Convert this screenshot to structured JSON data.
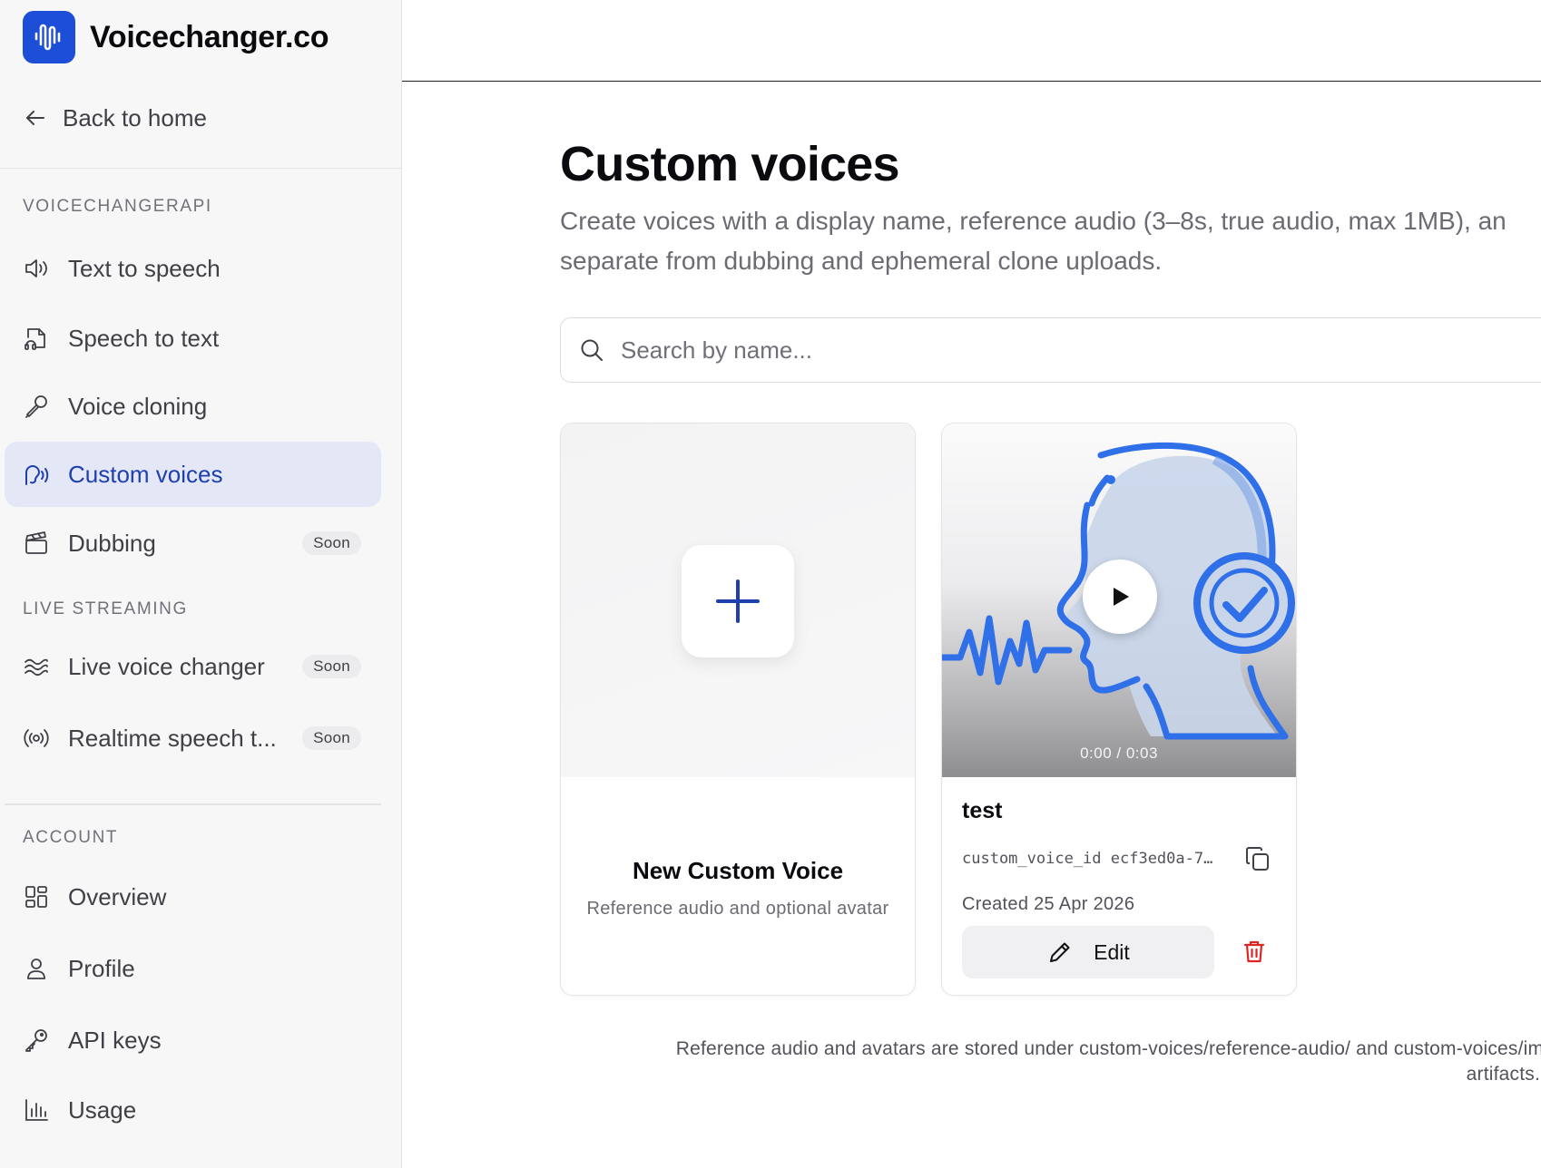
{
  "brand": {
    "name": "Voicechanger.co"
  },
  "sidebar": {
    "back_label": "Back to home",
    "sections": {
      "api": "VOICECHANGERAPI",
      "live": "LIVE STREAMING",
      "account": "ACCOUNT"
    },
    "items": [
      {
        "label": "Text to speech",
        "icon": "speaker-icon"
      },
      {
        "label": "Speech to text",
        "icon": "file-audio-icon"
      },
      {
        "label": "Voice cloning",
        "icon": "microphone-icon"
      },
      {
        "label": "Custom voices",
        "icon": "voice-wave-icon",
        "active": true
      },
      {
        "label": "Dubbing",
        "icon": "clapperboard-icon",
        "badge": "Soon"
      },
      {
        "label": "Live voice changer",
        "icon": "waves-icon",
        "badge": "Soon"
      },
      {
        "label": "Realtime speech t...",
        "icon": "broadcast-icon",
        "badge": "Soon"
      },
      {
        "label": "Overview",
        "icon": "dashboard-icon"
      },
      {
        "label": "Profile",
        "icon": "user-icon"
      },
      {
        "label": "API keys",
        "icon": "key-icon"
      },
      {
        "label": "Usage",
        "icon": "bar-chart-icon"
      }
    ]
  },
  "main": {
    "title": "Custom voices",
    "description_line1": "Create voices with a display name, reference audio (3–8s, true audio, max 1MB), an",
    "description_line2": "separate from dubbing and ephemeral clone uploads.",
    "search": {
      "placeholder": "Search by name..."
    },
    "new_card": {
      "title": "New Custom Voice",
      "subtitle": "Reference audio and optional avatar"
    },
    "voices": [
      {
        "name": "test",
        "id_text": "custom_voice_id ecf3ed0a-7…",
        "created": "Created 25 Apr 2026",
        "time": "0:00 / 0:03",
        "edit_label": "Edit"
      }
    ],
    "footnote_line1": "Reference audio and avatars are stored under custom-voices/reference-audio/ and custom-voices/imag",
    "footnote_line2": "artifacts."
  },
  "colors": {
    "accent": "#1d4ed8",
    "active_bg": "#e4e8f6",
    "active_text": "#1e3fb0",
    "delete": "#dc2626",
    "illustration_blue": "#2f6fe8"
  }
}
